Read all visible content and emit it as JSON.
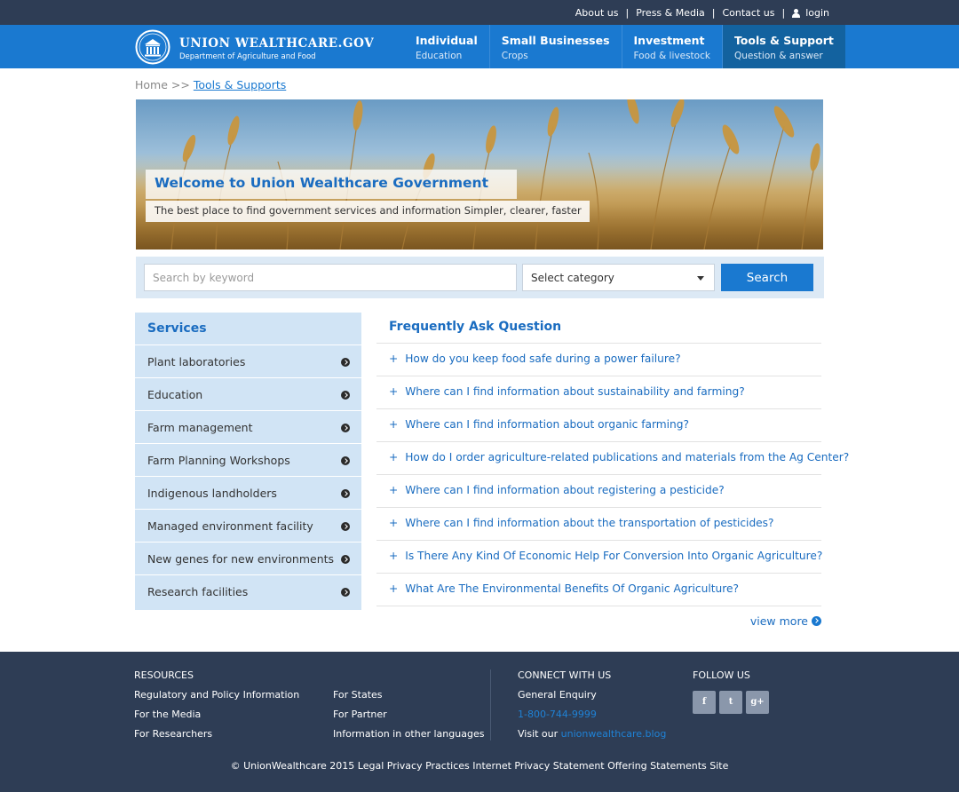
{
  "topbar": {
    "links": [
      "About us",
      "Press & Media",
      "Contact us"
    ],
    "login": "login",
    "icon": "user-icon"
  },
  "header": {
    "brand_name": "UNION WEALTHCARE.GOV",
    "brand_sub": "Department of Agriculture and Food",
    "nav": [
      {
        "title": "Individual",
        "sub": "Education",
        "active": false
      },
      {
        "title": "Small Businesses",
        "sub": "Crops",
        "active": false
      },
      {
        "title": "Investment",
        "sub": "Food & livestock",
        "active": false
      },
      {
        "title": "Tools & Support",
        "sub": "Question & answer",
        "active": true
      }
    ]
  },
  "breadcrumb": {
    "home": "Home",
    "separator": ">>",
    "current": "Tools & Supports"
  },
  "hero": {
    "title": "Welcome to Union Wealthcare Government",
    "subtitle": "The best place to find government services and information Simpler, clearer, faster"
  },
  "search": {
    "placeholder": "Search by keyword",
    "category": "Select category",
    "button": "Search"
  },
  "services": {
    "heading": "Services",
    "items": [
      "Plant laboratories",
      "Education",
      "Farm management",
      "Farm Planning Workshops",
      "Indigenous landholders",
      "Managed environment facility",
      "New genes for new environments",
      "Research facilities"
    ]
  },
  "faq": {
    "heading": "Frequently Ask Question",
    "items": [
      "How do you keep food safe during a power failure?",
      "Where can I find information about sustainability and farming?",
      "Where can I find information about organic farming?",
      "How do I order agriculture-related publications and materials from the Ag Center?",
      "Where can I find information about registering a pesticide?",
      "Where can I find information about the transportation of pesticides?",
      "Is There Any Kind Of Economic Help For Conversion Into Organic Agriculture?",
      "What Are The Environmental Benefits Of Organic Agriculture?"
    ],
    "view_more": "view more"
  },
  "footer": {
    "resources_heading": "RESOURCES",
    "resources_col1": [
      "Regulatory and Policy Information",
      "For the Media",
      "For Researchers"
    ],
    "resources_col2": [
      "For States",
      "For Partner",
      "Information in other languages"
    ],
    "connect_heading": "CONNECT WITH US",
    "general_enquiry": "General Enquiry",
    "phone": "1-800-744-9999",
    "visit_label": "Visit our",
    "blog": "unionwealthcare.blog",
    "follow_heading": "FOLLOW US",
    "social": [
      {
        "glyph": "f",
        "icon": "facebook-icon"
      },
      {
        "glyph": "t",
        "icon": "twitter-icon"
      },
      {
        "glyph": "g+",
        "icon": "google-plus-icon"
      }
    ],
    "copyright": "© UnionWealthcare 2015 Legal Privacy Practices Internet Privacy Statement Offering Statements Site"
  },
  "colors": {
    "primary": "#1a79d0",
    "dark_navy": "#2e3d55",
    "active_nav": "#13629f",
    "sidebar_bg": "#d1e4f5",
    "link_blue": "#1a6cc0"
  }
}
